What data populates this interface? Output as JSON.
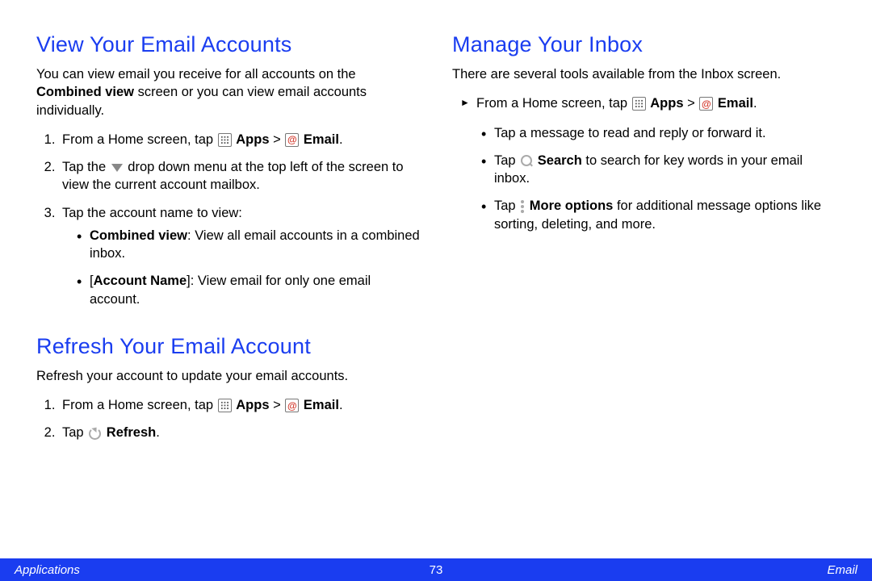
{
  "left": {
    "section1": {
      "heading": "View Your Email Accounts",
      "intro_pre": "You can view email you receive for all accounts on the ",
      "intro_bold": "Combined view",
      "intro_post": " screen or you can view email accounts individually.",
      "step1_pre": "From a Home screen, tap ",
      "step1_apps": "Apps",
      "step1_gt": " > ",
      "step1_email": "Email",
      "step1_end": ".",
      "step2_pre": "Tap the ",
      "step2_post": " drop down menu at the top left of the screen to view the current account mailbox.",
      "step3": "Tap the account name to view:",
      "bullet1_bold": "Combined view",
      "bullet1_rest": ": View all email accounts in a combined inbox.",
      "bullet2_pre": "[",
      "bullet2_bold": "Account Name",
      "bullet2_post": "]: View email for only one email account."
    },
    "section2": {
      "heading": "Refresh Your Email Account",
      "intro": "Refresh your account to update your email accounts.",
      "step1_pre": "From a Home screen, tap ",
      "step1_apps": "Apps",
      "step1_gt": " > ",
      "step1_email": "Email",
      "step1_end": ".",
      "step2_pre": "Tap ",
      "step2_bold": "Refresh",
      "step2_end": "."
    }
  },
  "right": {
    "section1": {
      "heading": "Manage Your Inbox",
      "intro": "There are several tools available from the Inbox screen.",
      "step1_pre": "From a Home screen, tap ",
      "step1_apps": "Apps",
      "step1_gt": " > ",
      "step1_email": "Email",
      "step1_end": ".",
      "bullet1": "Tap a message to read and reply or forward it.",
      "bullet2_pre": "Tap ",
      "bullet2_bold": "Search",
      "bullet2_post": " to search for key words in your email inbox.",
      "bullet3_pre": "Tap ",
      "bullet3_bold": "More options",
      "bullet3_post": " for additional message options like sorting, deleting, and more."
    }
  },
  "footer": {
    "left": "Applications",
    "page": "73",
    "right": "Email"
  }
}
